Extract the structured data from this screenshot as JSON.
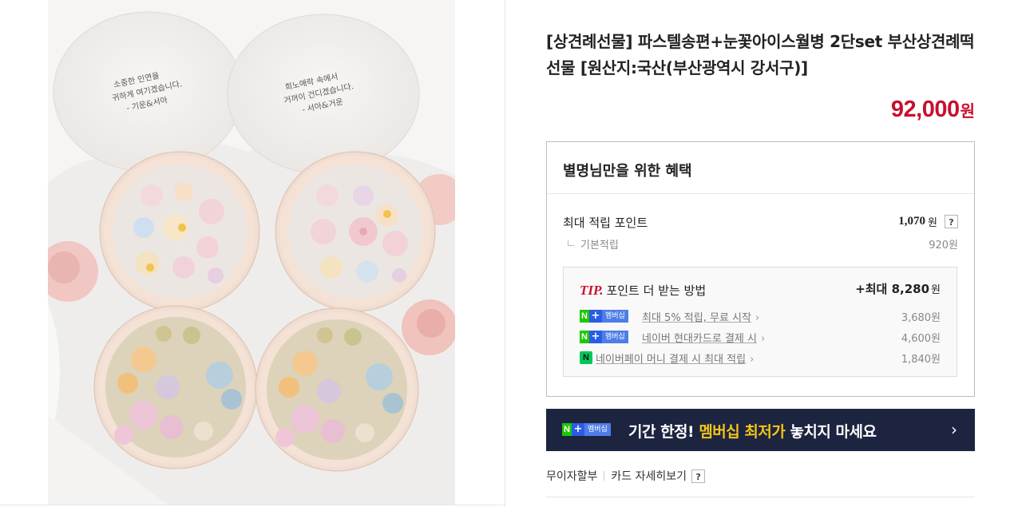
{
  "product_image": {
    "alt": "product-photo",
    "lid_text_left": [
      "소중한 인연을",
      "귀하게 여기겠습니다.",
      "- 기운&서아"
    ],
    "lid_text_right": [
      "희노애락 속에서",
      "거꺼이 건디겠습니다.",
      "- 서아&거운"
    ]
  },
  "product": {
    "title": "[상견례선물] 파스텔송편+눈꽃아이스월병 2단set 부산상견례떡선물 [원산지:국산(부산광역시 강서구)]",
    "price": "92,000",
    "price_unit": "원"
  },
  "benefit": {
    "heading": "별명님만을 위한 혜택",
    "max_points_label": "최대 적립 포인트",
    "max_points_value": "1,070",
    "won": "원",
    "help_icon": "?",
    "basic_label": "기본적립",
    "basic_value": "920원",
    "tip": {
      "tag": "TIP.",
      "heading": "포인트 더 받는 방법",
      "max_label": "+최대 8,280",
      "max_unit": "원",
      "items": [
        {
          "badge_n": "N",
          "badge_plus": "+",
          "badge_text": "멤버십",
          "text": "최대 5% 적립, 무료 시작",
          "chevron": "›",
          "amount": "3,680원"
        },
        {
          "badge_n": "N",
          "badge_plus": "+",
          "badge_text": "멤버십",
          "text": "네이버 현대카드로 결제 시",
          "chevron": "›",
          "amount": "4,600원"
        },
        {
          "icon_text": "N",
          "text": "네이버페이 머니 결제 시 최대 적립",
          "chevron": "›",
          "amount": "1,840원"
        }
      ]
    }
  },
  "banner": {
    "badge_n": "N",
    "badge_plus": "+",
    "badge_text": "멤버십",
    "text_before": "기간 한정! ",
    "text_highlight": "멤버십 최저가",
    "text_after": " 놓치지 마세요",
    "arrow": "›"
  },
  "links": {
    "installment": "무이자할부",
    "card_detail": "카드 자세히보기",
    "help_icon": "?"
  },
  "colors": {
    "price": "#c8102e",
    "banner_bg": "#1c2440",
    "banner_highlight": "#f5c518",
    "naver_green": "#1ec800",
    "membership_blue": "#4f7de8"
  }
}
